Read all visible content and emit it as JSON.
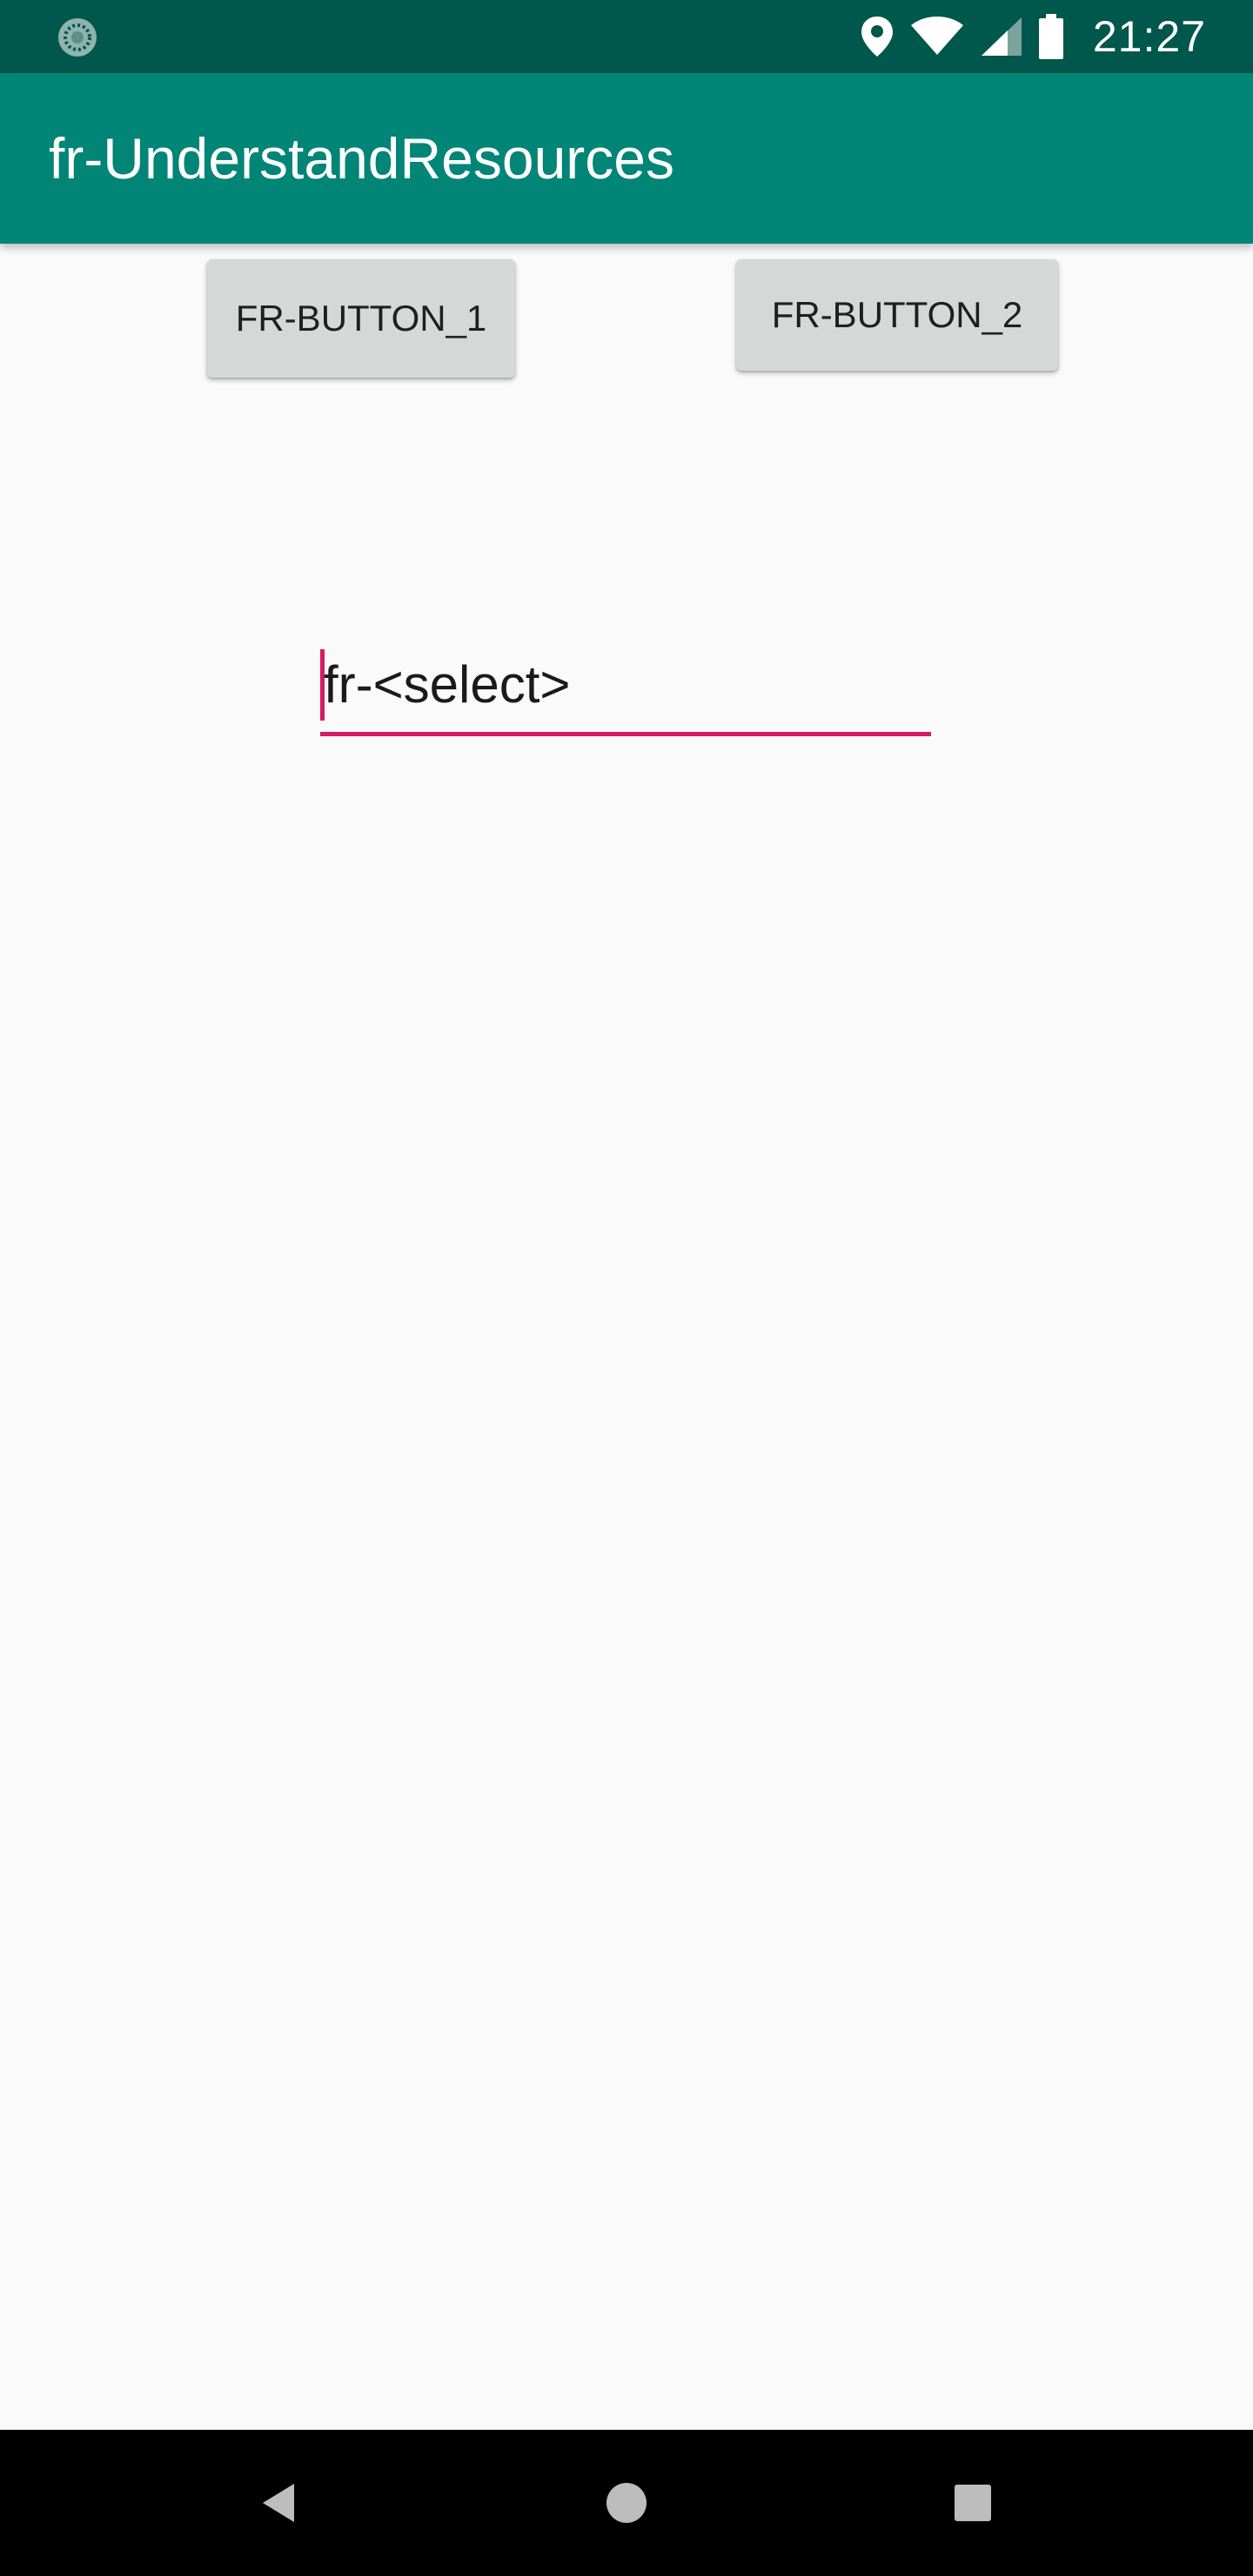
{
  "status_bar": {
    "time": "21:27",
    "icons": [
      "sync-icon",
      "location-icon",
      "wifi-icon",
      "cell-signal-icon",
      "battery-icon"
    ],
    "background_color": "#00574b"
  },
  "app_bar": {
    "title": "fr-UnderstandResources",
    "background_color": "#008577"
  },
  "buttons": {
    "button_1_label": "FR-BUTTON_1",
    "button_2_label": "FR-BUTTON_2"
  },
  "edit_field": {
    "value": "fr-<select>",
    "accent_color": "#d81b60"
  },
  "nav_bar": {
    "icons": [
      "back-icon",
      "home-icon",
      "recents-icon"
    ]
  }
}
